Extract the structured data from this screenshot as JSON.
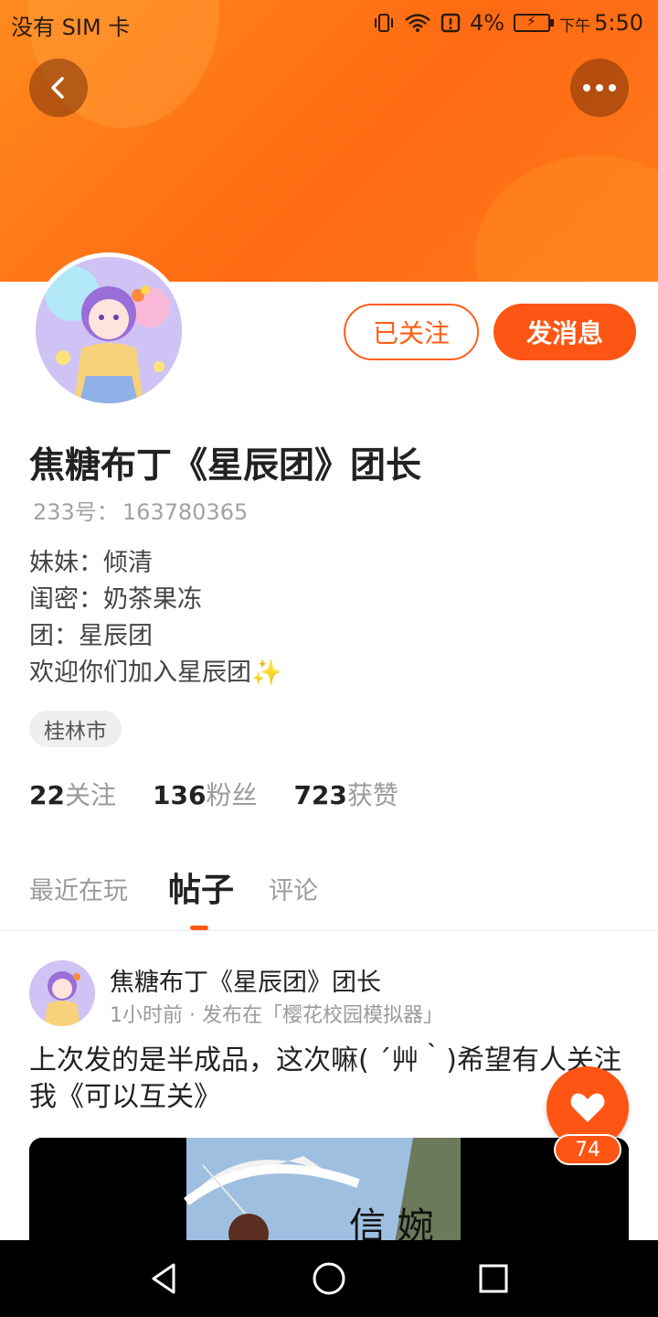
{
  "status_bar": {
    "carrier": "没有 SIM 卡",
    "battery_percent": "4%",
    "ampm": "下午",
    "time": "5:50"
  },
  "profile": {
    "name": "焦糖布丁《星辰团》团长",
    "uid_label": "233号：",
    "uid": "163780365",
    "bio": [
      "妹妹：倾清",
      "闺密：奶茶果冻",
      "团：星辰团",
      "欢迎你们加入星辰团"
    ],
    "bio_emoji": "✨",
    "location_tag": "桂林市",
    "follow_label": "已关注",
    "message_label": "发消息"
  },
  "stats": [
    {
      "num": "22",
      "label": "关注"
    },
    {
      "num": "136",
      "label": "粉丝"
    },
    {
      "num": "723",
      "label": "获赞"
    }
  ],
  "tabs": [
    {
      "label": "最近在玩"
    },
    {
      "label": "帖子"
    },
    {
      "label": "评论"
    }
  ],
  "post": {
    "author": "焦糖布丁《星辰团》团长",
    "meta": "1小时前 · 发布在「樱花校园模拟器」",
    "text": "上次发的是半成品，这次嘛( ´艸｀)希望有人关注我《可以互关》",
    "likes": "74"
  },
  "colors": {
    "accent": "#ff5514",
    "banner": "#ff7a1c"
  }
}
